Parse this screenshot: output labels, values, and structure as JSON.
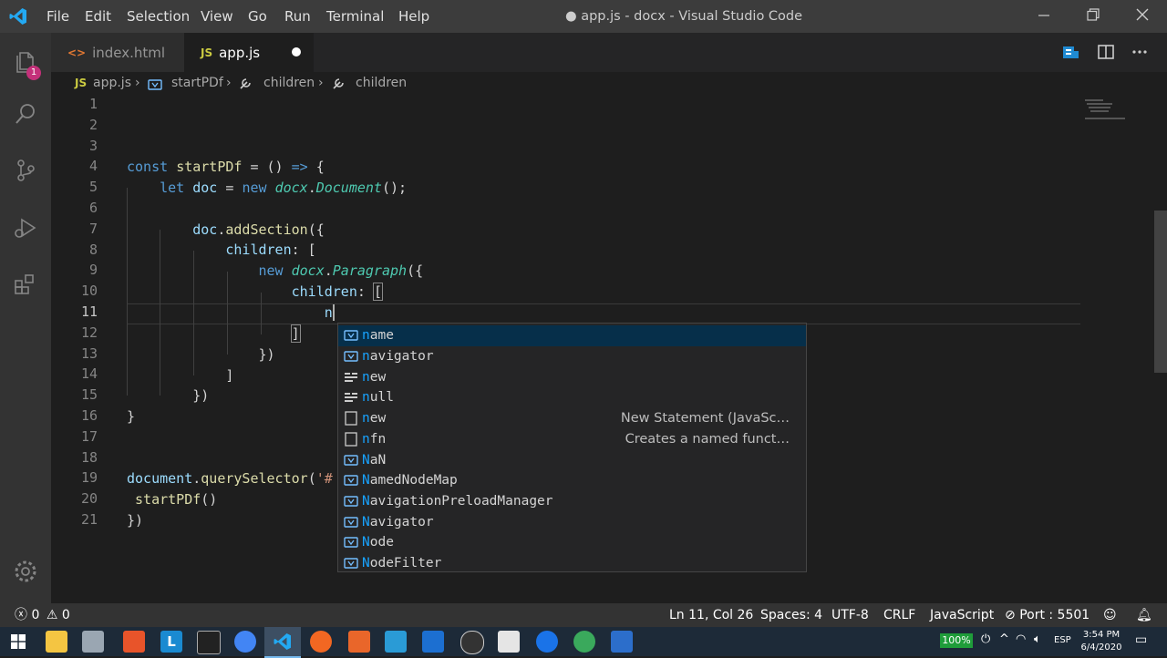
{
  "app": {
    "menu": [
      "File",
      "Edit",
      "Selection",
      "View",
      "Go",
      "Run",
      "Terminal",
      "Help"
    ],
    "window_title": "● app.js - docx - Visual Studio Code"
  },
  "activity_bar": {
    "explorer_badge": "1"
  },
  "tabs": [
    {
      "icon_text": "<>",
      "label": "index.html",
      "active": false
    },
    {
      "icon_text": "JS",
      "label": "app.js",
      "active": true,
      "dirty": true
    }
  ],
  "breadcrumbs": {
    "file_icon_text": "JS",
    "items": [
      "app.js",
      "startPDf",
      "children",
      "children"
    ]
  },
  "editor": {
    "line_numbers": [
      "1",
      "2",
      "3",
      "4",
      "5",
      "6",
      "7",
      "8",
      "9",
      "10",
      "11",
      "12",
      "13",
      "14",
      "15",
      "16",
      "17",
      "18",
      "19",
      "20",
      "21"
    ],
    "current_line": "11"
  },
  "suggestions": [
    {
      "kind": "variable-icon",
      "prefix": "n",
      "rest": "ame",
      "detail": "",
      "selected": true
    },
    {
      "kind": "variable-icon",
      "prefix": "n",
      "rest": "avigator",
      "detail": ""
    },
    {
      "kind": "keyword-icon",
      "prefix": "n",
      "rest": "ew",
      "detail": ""
    },
    {
      "kind": "keyword-icon",
      "prefix": "n",
      "rest": "ull",
      "detail": ""
    },
    {
      "kind": "snippet-icon",
      "prefix": "n",
      "rest": "ew",
      "detail": "New Statement (JavaSc…"
    },
    {
      "kind": "snippet-icon",
      "prefix": "n",
      "rest": "fn",
      "detail": "Creates a named funct…"
    },
    {
      "kind": "variable-icon",
      "prefix": "N",
      "rest": "aN",
      "detail": ""
    },
    {
      "kind": "variable-icon",
      "prefix": "N",
      "rest": "amedNodeMap",
      "detail": ""
    },
    {
      "kind": "variable-icon",
      "prefix": "N",
      "rest": "avigationPreloadManager",
      "detail": ""
    },
    {
      "kind": "variable-icon",
      "prefix": "N",
      "rest": "avigator",
      "detail": ""
    },
    {
      "kind": "variable-icon",
      "prefix": "N",
      "rest": "ode",
      "detail": ""
    },
    {
      "kind": "variable-icon",
      "prefix": "N",
      "rest": "odeFilter",
      "detail": ""
    }
  ],
  "status_bar": {
    "errors": "0",
    "warnings": "0",
    "position": "Ln 11, Col 26",
    "spaces": "Spaces: 4",
    "encoding": "UTF-8",
    "eol": "CRLF",
    "language": "JavaScript",
    "port": "Port : 5501"
  },
  "taskbar": {
    "battery": "100%",
    "lang": "ESP",
    "time": "3:54 PM",
    "date": "6/4/2020"
  },
  "colors": {
    "accent": "#007acc",
    "status_bg": "#333333",
    "editor_bg": "#1e1e1e"
  }
}
